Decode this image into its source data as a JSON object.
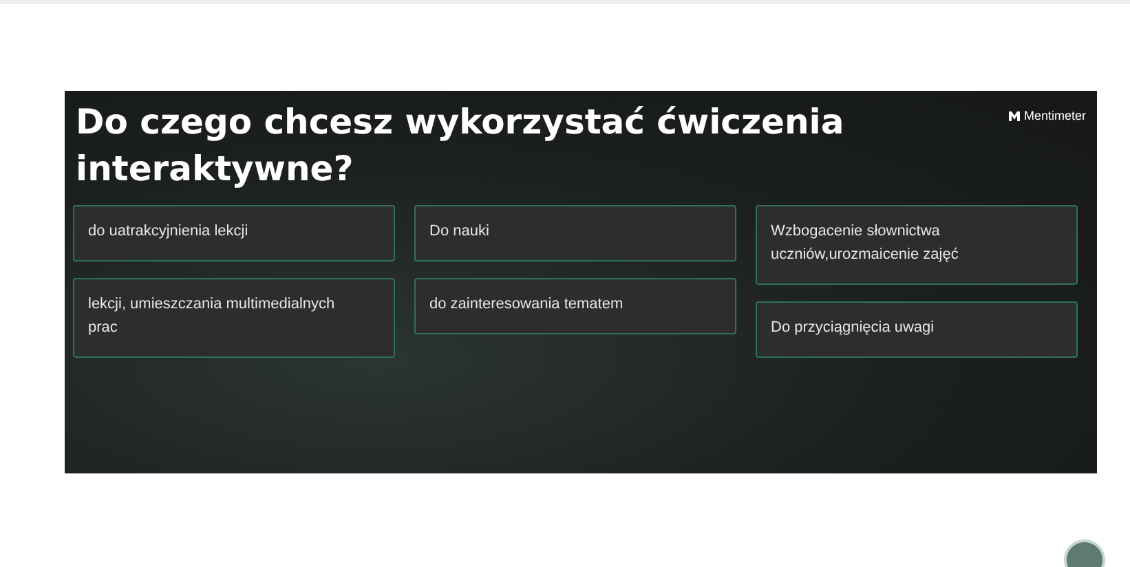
{
  "slide": {
    "title": "Do czego chcesz wykorzystać ćwiczenia interaktywne?",
    "brand": "Mentimeter",
    "columns": [
      {
        "responses": [
          "do uatrakcyjnienia lekcji",
          "lekcji, umieszczania multimedialnych prac"
        ]
      },
      {
        "responses": [
          "Do nauki",
          "do zainteresowania tematem"
        ]
      },
      {
        "responses": [
          "Wzbogacenie słownictwa uczniów,urozmaicenie zajęć",
          "Do przyciągnięcia uwagi"
        ]
      }
    ]
  }
}
